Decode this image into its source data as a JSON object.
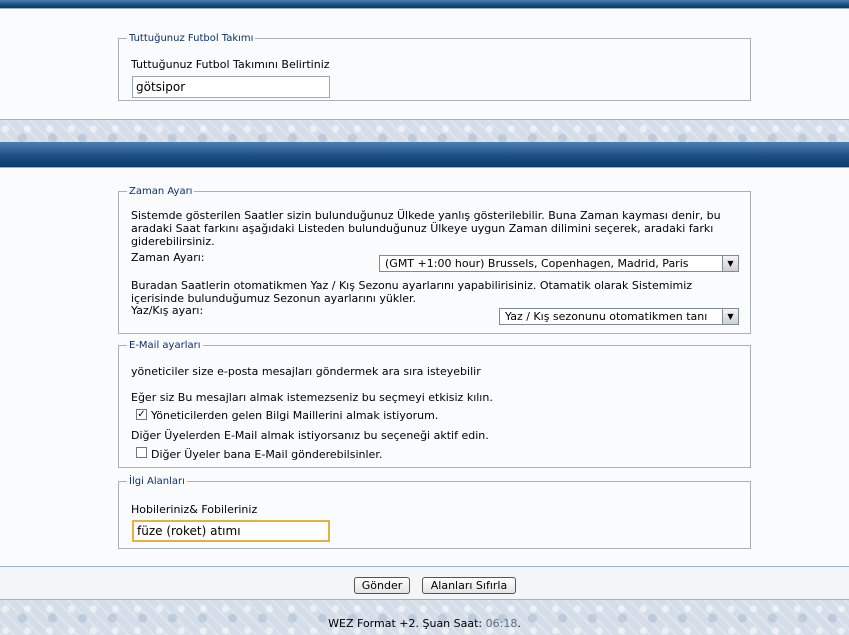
{
  "team": {
    "legend": "Tuttuğunuz Futbol Takımı",
    "label": "Tuttuğunuz Futbol Takımını Belirtiniz",
    "value": "götsipor"
  },
  "time": {
    "legend": "Zaman Ayarı",
    "description": "Sistemde gösterilen Saatler sizin bulunduğunuz Ülkede yanlış gösterilebilir. Buna Zaman kayması denir, bu aradaki Saat farkını aşağıdaki Listeden bulunduğunuz Ülkeye uygun Zaman dilimini seçerek, aradaki farkı giderebilirsiniz.",
    "zone_label": "Zaman Ayarı:",
    "zone_value": "(GMT +1:00 hour) Brussels, Copenhagen, Madrid, Paris",
    "dst_description": "Buradan Saatlerin otomatikmen Yaz / Kış Sezonu ayarlarını yapabilirisiniz. Otamatik olarak Sistemimiz içerisinde bulunduğumuz Sezonun ayarlarını yükler.",
    "dst_label": "Yaz/Kış ayarı:",
    "dst_value": "Yaz / Kış sezonunu otomatikmen tanı"
  },
  "email": {
    "legend": "E-Mail ayarları",
    "intro": "yöneticiler size e-posta mesajları göndermek ara sıra isteyebilir",
    "hint1": "Eğer siz Bu mesajları almak istemezseniz bu seçmeyi etkisiz kılın.",
    "admin_label": "Yöneticilerden gelen Bilgi Maillerini almak istiyorum.",
    "admin_checked": true,
    "hint2": "Diğer Üyelerden E-Mail almak istiyorsanız bu seçeneği aktif edin.",
    "members_label": "Diğer Üyeler bana E-Mail gönderebilsinler.",
    "members_checked": false
  },
  "interests": {
    "legend": "İlgi Alanları",
    "label": "Hobileriniz& Fobileriniz",
    "value": "füze (roket) atımı"
  },
  "buttons": {
    "submit": "Gönder",
    "reset": "Alanları Sıfırla"
  },
  "footer": {
    "format": "WEZ Format +2. Şuan Saat:",
    "time": "06:18",
    "period": "."
  },
  "icons": {
    "checkmark": "check-icon",
    "dropdown": "chevron-down-icon"
  }
}
